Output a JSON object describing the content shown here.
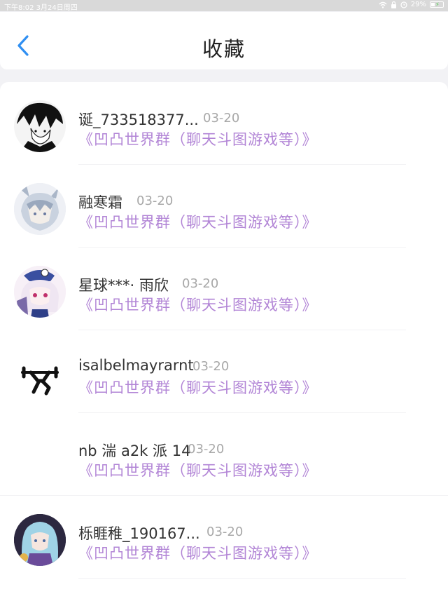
{
  "status_bar": {
    "time_date": "下午8:02   3月24日周四",
    "battery": "29%"
  },
  "nav": {
    "title": "收藏"
  },
  "favorites": [
    {
      "username": "诞_733518377...",
      "date": "03-20",
      "group": "《凹凸世界群（聊天斗图游戏等）》"
    },
    {
      "username": "融寒霜",
      "date": "03-20",
      "group": "《凹凸世界群（聊天斗图游戏等）》"
    },
    {
      "username": "星球***· 雨欣",
      "date": "03-20",
      "group": "《凹凸世界群（聊天斗图游戏等）》"
    },
    {
      "username": "isalbelmayrarnt",
      "date": "03-20",
      "group": "《凹凸世界群（聊天斗图游戏等）》"
    },
    {
      "username": "nb 湍 a2k 派 14",
      "date": "03-20",
      "group": "《凹凸世界群（聊天斗图游戏等）》"
    },
    {
      "username": "栎睚稚_190167...",
      "date": "03-20",
      "group": "《凹凸世界群（聊天斗图游戏等）》"
    }
  ],
  "icons": {
    "back": "chevron-left-icon",
    "wifi": "wifi-icon",
    "lock": "lock-icon",
    "alarm": "alarm-icon",
    "battery": "battery-icon"
  },
  "colors": {
    "accent_blue": "#2f8ff2",
    "group_purple": "#b285d6",
    "date_gray": "#a8a8a8"
  }
}
